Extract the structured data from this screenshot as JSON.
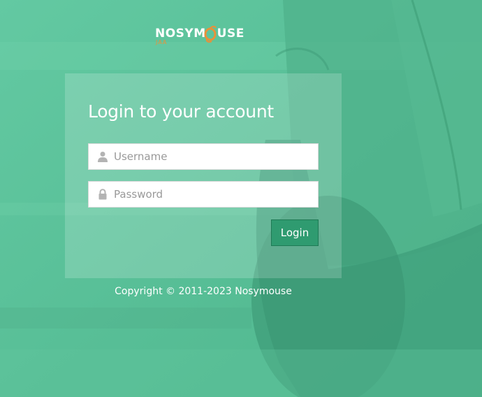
{
  "brand": {
    "name_left": "NOSYM",
    "name_right": "USE",
    "tagline": "JAA",
    "text_color": "#ffffff",
    "accent_color": "#e8913a"
  },
  "login": {
    "title": "Login to your account",
    "username": {
      "placeholder": "Username",
      "value": "",
      "icon": "user-icon"
    },
    "password": {
      "placeholder": "Password",
      "value": "",
      "icon": "lock-icon"
    },
    "submit_label": "Login"
  },
  "footer": {
    "copyright": "Copyright © 2011-2023 Nosymouse"
  },
  "theme": {
    "background": "#5cc59c",
    "button_color": "#2f9b70"
  }
}
